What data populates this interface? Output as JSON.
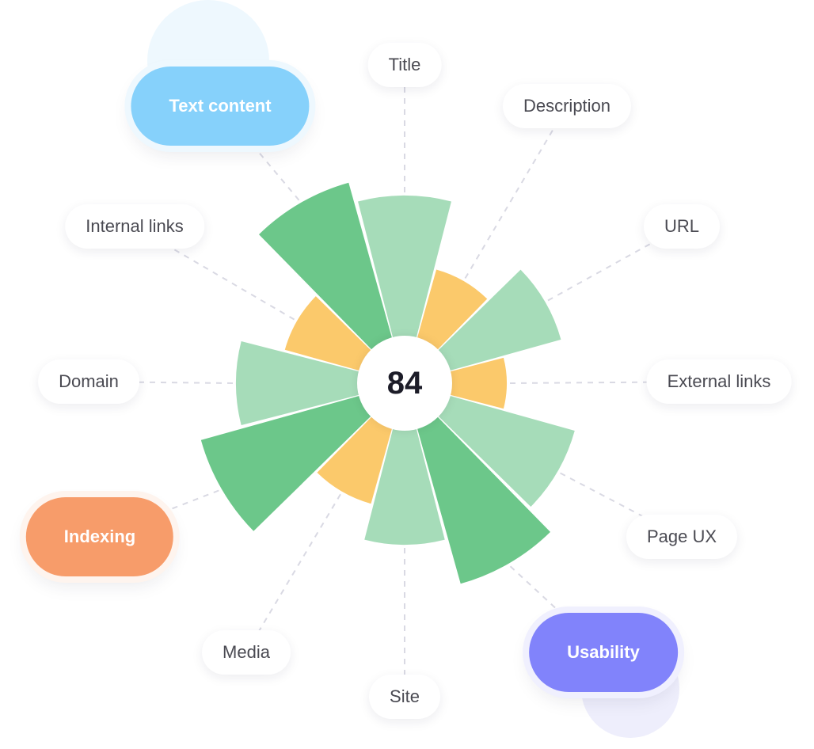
{
  "chart_data": {
    "type": "polar-area",
    "title": "",
    "score": "84",
    "categories": [
      "Title",
      "Description",
      "URL",
      "External links",
      "Page UX",
      "Usability",
      "Site",
      "Media",
      "Indexing",
      "Domain",
      "Internal links",
      "Text content"
    ],
    "values": [
      237,
      149,
      205,
      129,
      223,
      263,
      204,
      158,
      267,
      213,
      157,
      263
    ],
    "value_scale": "relative segment length",
    "segment_colors": [
      "#a6dcb9",
      "#fbc96b",
      "#a6dcb9",
      "#fbc96b",
      "#a6dcb9",
      "#6cc78a",
      "#a6dcb9",
      "#fbc96b",
      "#6cc78a",
      "#a6dcb9",
      "#fbc96b",
      "#6cc78a"
    ]
  },
  "labels": [
    {
      "text": "Title",
      "style": "plain"
    },
    {
      "text": "Description",
      "style": "plain"
    },
    {
      "text": "URL",
      "style": "plain"
    },
    {
      "text": "External links",
      "style": "plain"
    },
    {
      "text": "Page UX",
      "style": "plain"
    },
    {
      "text": "Usability",
      "style": "highlight",
      "color": "#8183fb",
      "halo": "#f0f0fe"
    },
    {
      "text": "Site",
      "style": "plain"
    },
    {
      "text": "Media",
      "style": "plain"
    },
    {
      "text": "Indexing",
      "style": "highlight",
      "color": "#f79c6a",
      "halo": "#fef4ee"
    },
    {
      "text": "Domain",
      "style": "plain"
    },
    {
      "text": "Internal links",
      "style": "plain"
    },
    {
      "text": "Text content",
      "style": "highlight",
      "color": "#86d1fb",
      "halo": "#eef8fe"
    }
  ],
  "colors": {
    "light_green": "#a6dcb9",
    "dark_green": "#6cc78a",
    "yellow": "#fbc96b",
    "leader_line": "#d9d9e3"
  }
}
